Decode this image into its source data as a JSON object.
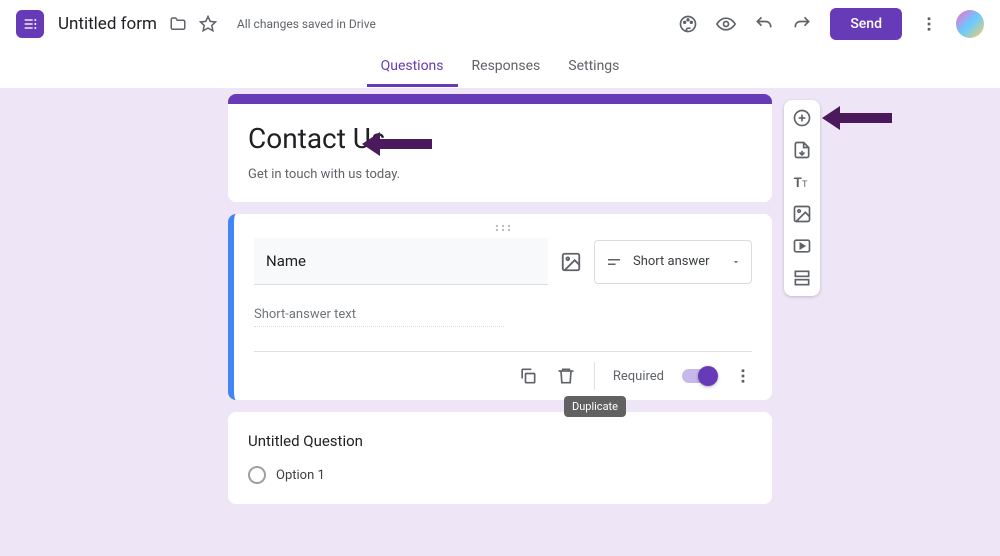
{
  "header": {
    "doc_title": "Untitled form",
    "save_status": "All changes saved in Drive",
    "send_label": "Send"
  },
  "tabs": {
    "questions": "Questions",
    "responses": "Responses",
    "settings": "Settings"
  },
  "form": {
    "title": "Contact Us",
    "description": "Get in touch with us today."
  },
  "question1": {
    "text": "Name",
    "placeholder_line": "Short-answer text",
    "type_label": "Short answer",
    "required_label": "Required",
    "required_on": true
  },
  "tooltip": {
    "duplicate": "Duplicate"
  },
  "question2": {
    "title": "Untitled Question",
    "option1": "Option 1"
  },
  "icons": {
    "logo": "forms-logo",
    "folder": "folder-icon",
    "star": "star-icon",
    "palette": "palette-icon",
    "preview": "eye-icon",
    "undo": "undo-icon",
    "redo": "redo-icon",
    "more": "more-vert-icon",
    "image": "image-icon",
    "short_answer": "short-answer-icon",
    "caret": "caret-down-icon",
    "copy": "copy-icon",
    "delete": "trash-icon",
    "more_q": "more-vert-icon",
    "add": "add-circle-icon",
    "import": "import-icon",
    "title_tool": "title-icon",
    "image_tool": "image-icon",
    "video_tool": "video-icon",
    "section_tool": "section-icon"
  }
}
